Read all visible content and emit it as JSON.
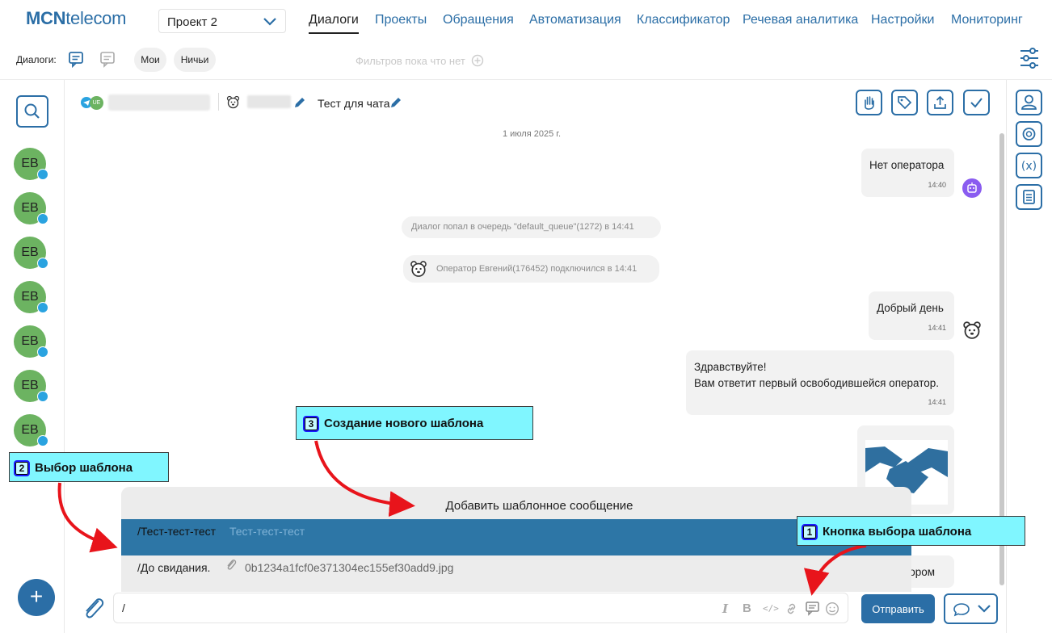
{
  "header": {
    "logo_bold": "MCN",
    "logo_rest": "telecom",
    "project": "Проект 2",
    "nav": [
      "Диалоги",
      "Проекты",
      "Обращения",
      "Автоматизация",
      "Классификатор",
      "Речевая аналитика",
      "Настройки",
      "Мониторинг"
    ]
  },
  "filters": {
    "label": "Диалоги:",
    "mine": "Мои",
    "nobodys": "Ничьи",
    "empty": "Фильтров пока что нет"
  },
  "sidebar": {
    "avatars": [
      "ЕВ",
      "ЕВ",
      "ЕВ",
      "ЕВ",
      "ЕВ",
      "ЕВ",
      "ЕВ"
    ]
  },
  "chat": {
    "badge": "UE",
    "name": "Тест для чата",
    "date": "1 июля 2025 г.",
    "messages": [
      {
        "text": "Нет оператора",
        "time": "14:40"
      },
      {
        "system": "Диалог попал в очередь \"default_queue\"(1272) в 14:41"
      },
      {
        "system": "Оператор Евгений(176452) подключился в 14:41"
      },
      {
        "text": "Добрый день",
        "time": "14:41"
      },
      {
        "text_line1": "Здравствуйте!",
        "text_line2": "Вам ответит первый освободившейся оператор.",
        "time": "14:41"
      },
      {
        "partial": "атором"
      }
    ]
  },
  "templates": {
    "add_label": "Добавить шаблонное сообщение",
    "items": [
      {
        "key": "/Тест-тест-тест",
        "value": "Тест-тест-тест"
      },
      {
        "key": "/До свидания.",
        "value": "0b1234a1fcf0e371304ec155ef30add9.jpg"
      }
    ]
  },
  "composer": {
    "value": "/",
    "send": "Отправить"
  },
  "annotations": [
    {
      "num": "1",
      "text": "Кнопка выбора шаблона"
    },
    {
      "num": "2",
      "text": "Выбор шаблона"
    },
    {
      "num": "3",
      "text": "Создание нового шаблона"
    }
  ],
  "colors": {
    "brand": "#2b6ea6",
    "avatar": "#6cb361",
    "telegram": "#2aa3e0",
    "annotation": "#80f6ff",
    "arrow": "#e8141b"
  }
}
